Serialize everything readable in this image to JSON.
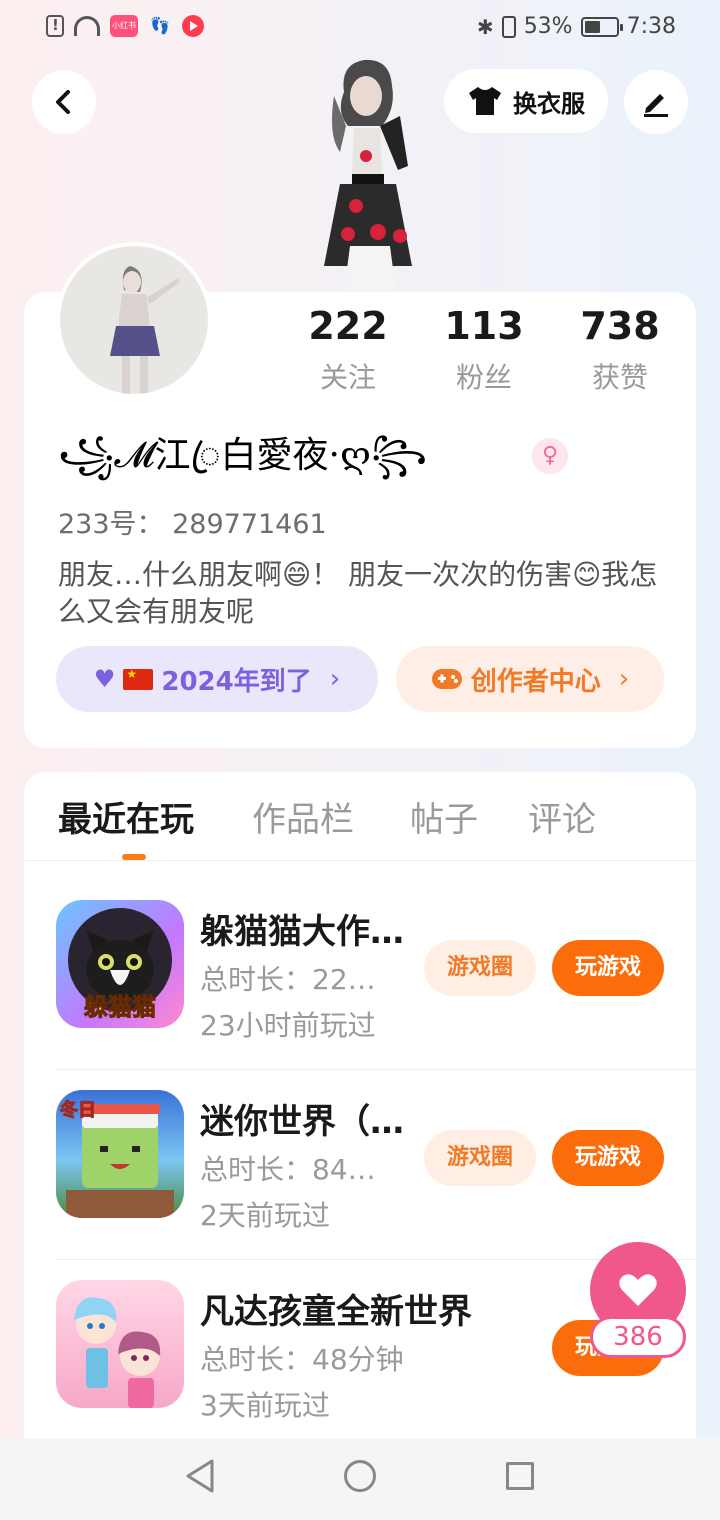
{
  "status_bar": {
    "battery": "53%",
    "time": "7:38",
    "mini_label": "小红书",
    "icons": [
      "alert-icon",
      "wifi-icon",
      "app-icon",
      "footprint-icon",
      "play-icon",
      "bluetooth-icon",
      "vibrate-icon",
      "battery-icon"
    ]
  },
  "header": {
    "outfit_label": "换衣服"
  },
  "profile": {
    "stats": [
      {
        "value": "222",
        "label": "关注"
      },
      {
        "value": "113",
        "label": "粉丝"
      },
      {
        "value": "738",
        "label": "获赞"
      }
    ],
    "nickname": "꧁𝓜江ꦿ白愛夜·ღ꧂",
    "gender_symbol": "♀",
    "uid": "233号：  289771461",
    "bio": "朋友…什么朋友啊😄！ 朋友一次次的伤害😊我怎么又会有朋友呢",
    "badge_label": "2024年到了",
    "creator_label": "创作者中心"
  },
  "tabs": [
    {
      "label": "最近在玩",
      "active": true
    },
    {
      "label": "作品栏",
      "active": false
    },
    {
      "label": "帖子",
      "active": false
    },
    {
      "label": "评论",
      "active": false
    }
  ],
  "games": [
    {
      "title": "躲猫猫大作…",
      "duration": "总时长：22…",
      "last_played": "23小时前玩过",
      "circle_label": "游戏圈",
      "play_label": "玩游戏",
      "icon_text": "躲猫猫"
    },
    {
      "title": "迷你世界（…",
      "duration": "总时长：84…",
      "last_played": "2天前玩过",
      "circle_label": "游戏圈",
      "play_label": "玩游戏",
      "icon_text": "冬日"
    },
    {
      "title": "凡达孩童全新世界",
      "duration": "总时长：48分钟",
      "last_played": "3天前玩过",
      "circle_label": "",
      "play_label": "玩游戏",
      "icon_text": ""
    }
  ],
  "like": {
    "count": "386"
  },
  "colors": {
    "accent": "#fb6d0a",
    "purple": "#7b61e0",
    "pink": "#f0578a"
  }
}
